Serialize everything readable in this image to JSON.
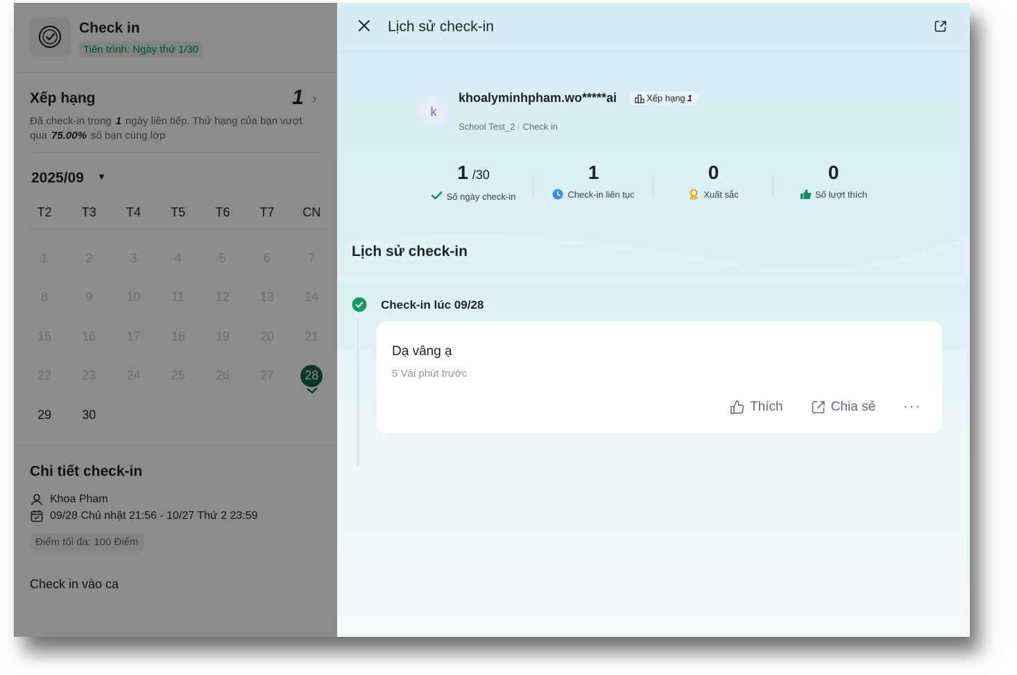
{
  "left": {
    "header": {
      "title": "Check in",
      "progress": "Tiến trình: Ngày thứ 1/30"
    },
    "ranking": {
      "title": "Xếp hạng",
      "rank": "1",
      "desc_prefix": "Đã check-in trong",
      "streak_days": "1",
      "desc_middle": "ngày liên tiếp. Thứ hạng của bạn vượt qua",
      "percent": "75.00%",
      "desc_suffix": "số bạn cùng lớp"
    },
    "calendar": {
      "month": "2025/09",
      "weekdays": [
        "T2",
        "T3",
        "T4",
        "T5",
        "T6",
        "T7",
        "CN"
      ],
      "days": [
        "1",
        "2",
        "3",
        "4",
        "5",
        "6",
        "7",
        "8",
        "9",
        "10",
        "11",
        "12",
        "13",
        "14",
        "15",
        "16",
        "17",
        "18",
        "19",
        "20",
        "21",
        "22",
        "23",
        "24",
        "25",
        "26",
        "27",
        "28",
        "29",
        "30"
      ],
      "selected_day": "28",
      "active_days": [
        "28",
        "29",
        "30"
      ]
    },
    "detail": {
      "title": "Chi tiết check-in",
      "user": "Khoa Pham",
      "period": "09/28 Chủ nhật 21:56 - 10/27 Thứ 2 23:59",
      "max_points": "Điểm tối đa: 100 Điểm",
      "shift_label": "Check in vào ca"
    }
  },
  "drawer": {
    "title": "Lịch sử check-in",
    "profile": {
      "avatar_letter": "k",
      "username": "khoalyminhpham.wo*****ai",
      "rank_label": "Xếp hạng",
      "rank_value": "1",
      "school": "School Test_2",
      "activity": "Check in"
    },
    "stats": [
      {
        "value": "1",
        "suffix": "/30",
        "label": "Số ngày check-in",
        "icon": "check-icon",
        "color": "#0a8f55"
      },
      {
        "value": "1",
        "suffix": "",
        "label": "Check-in liên tục",
        "icon": "clock-icon",
        "color": "#3b8ef0"
      },
      {
        "value": "0",
        "suffix": "",
        "label": "Xuất sắc",
        "icon": "medal-icon",
        "color": "#f5a623"
      },
      {
        "value": "0",
        "suffix": "",
        "label": "Số lượt thích",
        "icon": "thumbs-up-icon",
        "color": "#0a8f55"
      }
    ],
    "history_title": "Lịch sử check-in",
    "entries": [
      {
        "label": "Check-in lúc 09/28",
        "content": "Dạ vâng ạ",
        "time": "5 Vài phút trước",
        "like_label": "Thích",
        "share_label": "Chia sẻ",
        "more_label": "···"
      }
    ]
  },
  "colors": {
    "accent_green": "#0b6b46",
    "drawer_bg": "#d5eef3"
  }
}
